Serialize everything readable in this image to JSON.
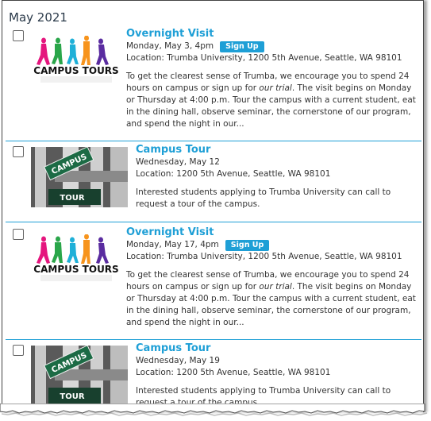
{
  "month_heading": "May 2021",
  "events": [
    {
      "title": "Overnight Visit",
      "date": "Monday, May 3, 4pm",
      "signup_label": "Sign Up",
      "location": "Location: Trumba University, 1200 5th Avenue, Seattle, WA 98101",
      "desc_before": "To get the clearest sense of Trumba, we encourage you to spend 24 hours on campus or sign up for ",
      "desc_italic": "our trial",
      "desc_after": ". The visit begins on Monday or Thursday at 4:00 p.m. Tour the campus with a current student, eat in the dining hall, observe seminar, the cornerstone of our program, and spend the night in our...",
      "image": "campus-tours-logo",
      "image_text": "CAMPUS TOURS"
    },
    {
      "title": "Campus Tour",
      "date": "Wednesday, May 12",
      "location": "Location: 1200 5th Avenue, Seattle, WA 98101",
      "description": "Interested students applying to Trumba University can call to request a tour of the campus.",
      "image": "campus-tour-street-sign",
      "sign_top": "CAMPUS",
      "sign_bottom": "TOUR"
    },
    {
      "title": "Overnight Visit",
      "date": "Monday, May 17, 4pm",
      "signup_label": "Sign Up",
      "location": "Location: Trumba University, 1200 5th Avenue, Seattle, WA 98101",
      "desc_before": "To get the clearest sense of Trumba, we encourage you to spend 24 hours on campus or sign up for ",
      "desc_italic": "our trial",
      "desc_after": ". The visit begins on Monday or Thursday at 4:00 p.m. Tour the campus with a current student, eat in the dining hall, observe seminar, the cornerstone of our program, and spend the night in our...",
      "image": "campus-tours-logo",
      "image_text": "CAMPUS TOURS"
    },
    {
      "title": "Campus Tour",
      "date": "Wednesday, May 19",
      "location": "Location: 1200 5th Avenue, Seattle, WA 98101",
      "description": "Interested students applying to Trumba University can call to request a tour of the campus.",
      "image": "campus-tour-street-sign",
      "sign_top": "CAMPUS",
      "sign_bottom": "TOUR"
    }
  ],
  "colors": {
    "accent": "#1e9fd6",
    "text": "#333333",
    "heading": "#2b3a4a"
  }
}
